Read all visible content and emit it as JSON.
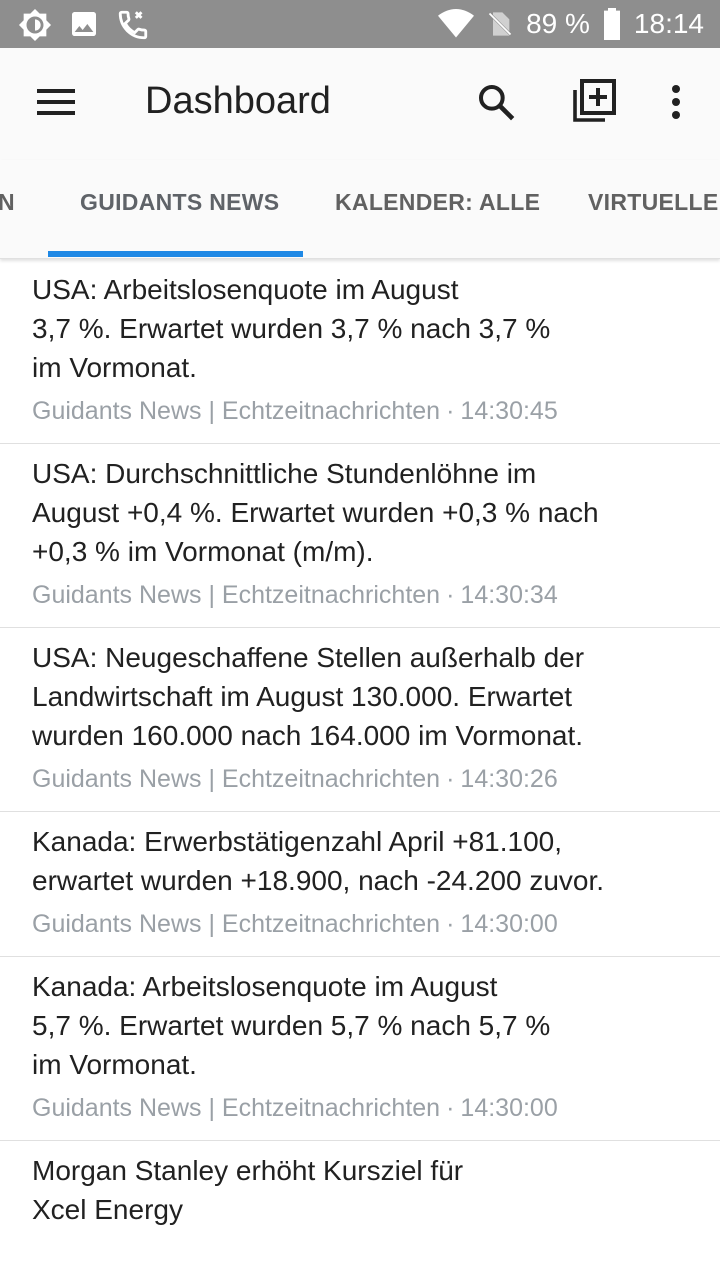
{
  "status_bar": {
    "battery_percent": "89 %",
    "time": "18:14",
    "icons": [
      "brightness-icon",
      "image-icon",
      "phone-call-icon",
      "wifi-icon",
      "no-sim-icon",
      "battery-icon"
    ]
  },
  "app_bar": {
    "title": "Dashboard",
    "icons": [
      "menu-icon",
      "search-icon",
      "add-box-icon",
      "more-vert-icon"
    ]
  },
  "tabs": [
    {
      "label": "N",
      "active": false
    },
    {
      "label": "GUIDANTS NEWS",
      "active": true
    },
    {
      "label": "KALENDER: ALLE",
      "active": false
    },
    {
      "label": "VIRTUELLE D",
      "active": false
    }
  ],
  "news": [
    {
      "title": "USA: Arbeitslosenquote im August\n3,7 %. Erwartet wurden 3,7 % nach 3,7 %\nim Vormonat.",
      "source": "Guidants News | Echtzeitnachrichten",
      "time": "14:30:45"
    },
    {
      "title": "USA: Durchschnittliche Stundenlöhne im\nAugust +0,4 %. Erwartet wurden +0,3 % nach\n+0,3 % im Vormonat (m/m).",
      "source": "Guidants News | Echtzeitnachrichten",
      "time": "14:30:34"
    },
    {
      "title": "USA: Neugeschaffene Stellen außerhalb der\nLandwirtschaft im August 130.000. Erwartet\nwurden 160.000 nach 164.000 im Vormonat.",
      "source": "Guidants News | Echtzeitnachrichten",
      "time": "14:30:26"
    },
    {
      "title": "Kanada: Erwerbstätigenzahl April +81.100,\nerwartet wurden +18.900, nach -24.200 zuvor.",
      "source": "Guidants News | Echtzeitnachrichten",
      "time": "14:30:00"
    },
    {
      "title": "Kanada: Arbeitslosenquote im August\n5,7 %. Erwartet wurden 5,7 % nach 5,7 %\nim Vormonat.",
      "source": "Guidants News | Echtzeitnachrichten",
      "time": "14:30:00"
    },
    {
      "title": "Morgan Stanley erhöht Kursziel für\nXcel Energy",
      "source": "",
      "time": ""
    }
  ],
  "colors": {
    "status_bar": "#8e8e8e",
    "app_bar": "#fafafa",
    "tab_indicator": "#1e88e5",
    "meta_text": "#9aa0a6"
  }
}
